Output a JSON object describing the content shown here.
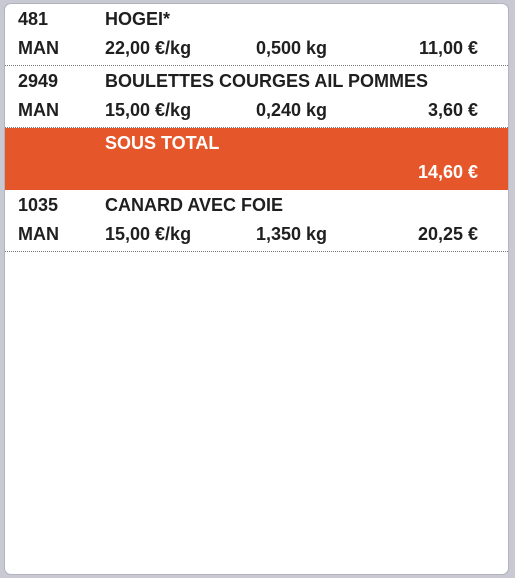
{
  "ticket": {
    "items": [
      {
        "code": "481",
        "name": "HOGEI*",
        "mode": "MAN",
        "unit_price": "22,00 €/kg",
        "weight": "0,500 kg",
        "total": "11,00 €"
      },
      {
        "code": "2949",
        "name": "BOULETTES COURGES AIL POMMES",
        "mode": "MAN",
        "unit_price": "15,00 €/kg",
        "weight": "0,240 kg",
        "total": "3,60 €"
      },
      {
        "code": "1035",
        "name": "CANARD AVEC FOIE",
        "mode": "MAN",
        "unit_price": "15,00 €/kg",
        "weight": "1,350 kg",
        "total": "20,25 €"
      }
    ],
    "subtotal": {
      "label": "SOUS TOTAL",
      "value": "14,60 €"
    },
    "colors": {
      "accent": "#e5572a",
      "background": "#ffffff",
      "text": "#1f1f1f"
    }
  }
}
